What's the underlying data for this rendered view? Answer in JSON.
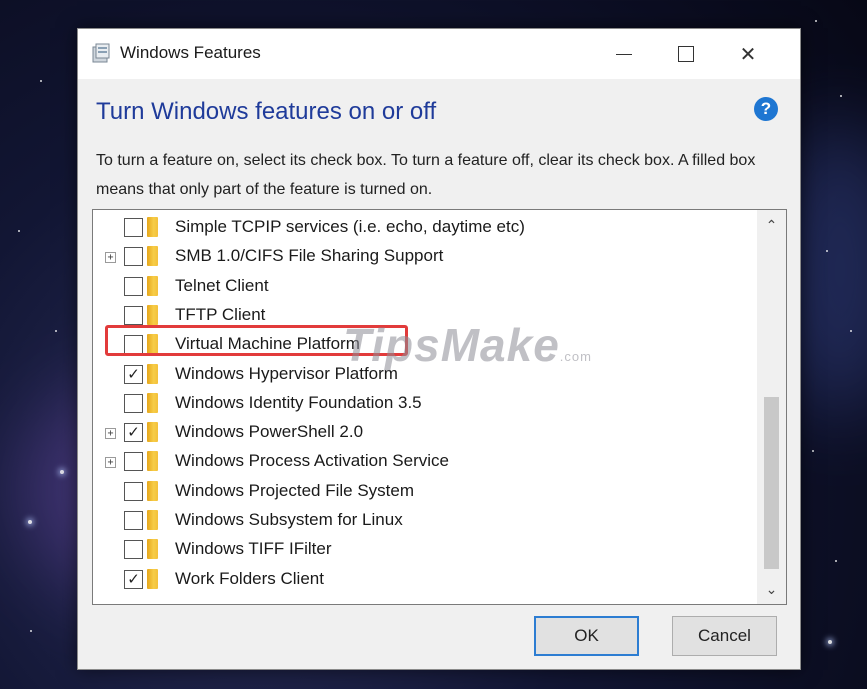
{
  "window": {
    "title": "Windows Features",
    "controls": {
      "minimize": "—",
      "maximize": "☐",
      "close": "✕"
    }
  },
  "heading": "Turn Windows features on or off",
  "help_icon": "?",
  "description": "To turn a feature on, select its check box. To turn a feature off, clear its check box. A filled box means that only part of the feature is turned on.",
  "features": [
    {
      "label": "Simple TCPIP services (i.e. echo, daytime etc)",
      "checked": false,
      "expandable": false
    },
    {
      "label": "SMB 1.0/CIFS File Sharing Support",
      "checked": false,
      "expandable": true
    },
    {
      "label": "Telnet Client",
      "checked": false,
      "expandable": false
    },
    {
      "label": "TFTP Client",
      "checked": false,
      "expandable": false
    },
    {
      "label": "Virtual Machine Platform",
      "checked": false,
      "expandable": false
    },
    {
      "label": "Windows Hypervisor Platform",
      "checked": true,
      "expandable": false
    },
    {
      "label": "Windows Identity Foundation 3.5",
      "checked": false,
      "expandable": false
    },
    {
      "label": "Windows PowerShell 2.0",
      "checked": true,
      "expandable": true
    },
    {
      "label": "Windows Process Activation Service",
      "checked": false,
      "expandable": true
    },
    {
      "label": "Windows Projected File System",
      "checked": false,
      "expandable": false
    },
    {
      "label": "Windows Subsystem for Linux",
      "checked": false,
      "expandable": false
    },
    {
      "label": "Windows TIFF IFilter",
      "checked": false,
      "expandable": false
    },
    {
      "label": "Work Folders Client",
      "checked": true,
      "expandable": false
    }
  ],
  "scroll": {
    "up": "⌃",
    "down": "⌄"
  },
  "watermark": {
    "main": "TipsMake",
    "suffix": ".com"
  },
  "buttons": {
    "ok": "OK",
    "cancel": "Cancel"
  },
  "colors": {
    "heading": "#1f3b9a",
    "highlight": "#e23b3b",
    "help": "#1e76d2"
  }
}
